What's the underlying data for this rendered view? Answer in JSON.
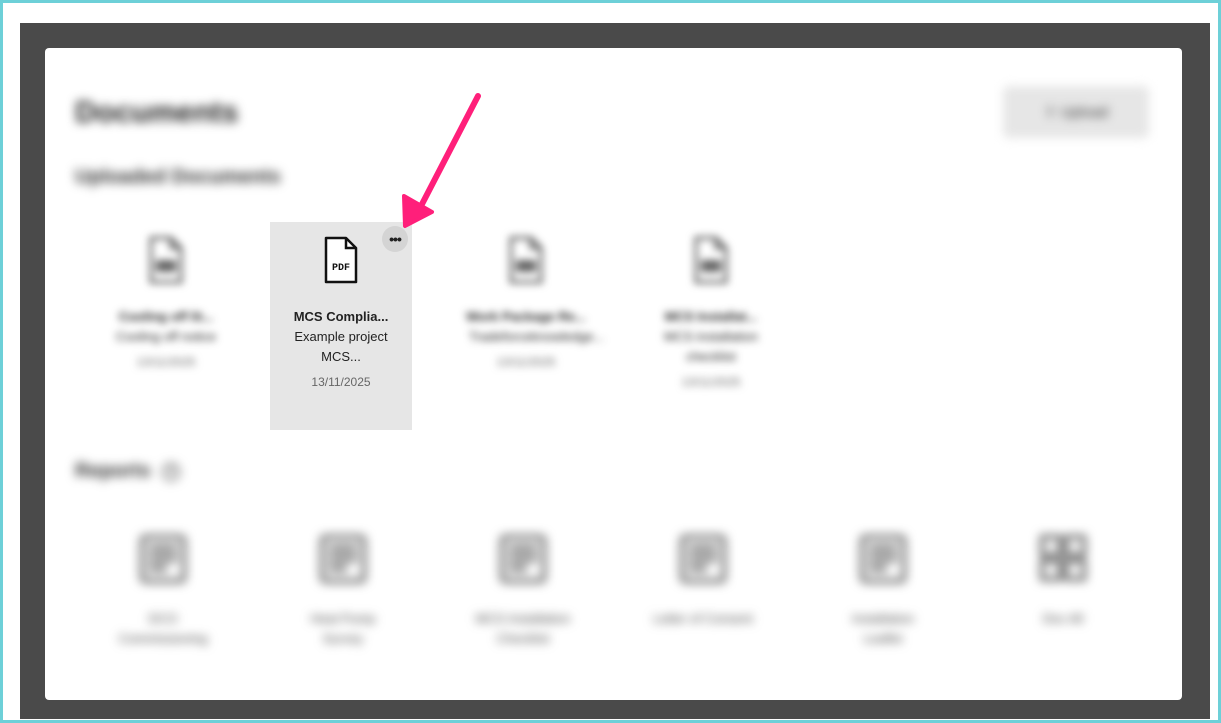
{
  "page": {
    "title": "Documents",
    "upload_label": "⇪ Upload"
  },
  "sections": {
    "uploaded": "Uploaded Documents",
    "reports": "Reports",
    "reports_help_icon": "question-circle-icon"
  },
  "documents": [
    {
      "name": "Cooling off lit...",
      "desc": "Cooling off notice",
      "date": "13/11/2025",
      "icon": "document-icon",
      "blurred": true
    },
    {
      "name": "MCS Complia...",
      "desc": "Example project MCS...",
      "date": "13/11/2025",
      "icon": "pdf-file-icon",
      "blurred": false
    },
    {
      "name": "Work Package Re...",
      "desc": "Tradeforceknowledge...",
      "date": "13/11/2025",
      "icon": "document-icon",
      "blurred": true
    },
    {
      "name": "MCS Installat...",
      "desc": "MCS installation checklist",
      "date": "13/11/2025",
      "icon": "document-icon",
      "blurred": true
    }
  ],
  "reports": [
    {
      "name": "DCO Commissioning",
      "icon": "report-icon"
    },
    {
      "name": "Heat Pump Survey",
      "icon": "report-icon"
    },
    {
      "name": "MCS Installation Checklist",
      "icon": "report-icon"
    },
    {
      "name": "Letter of Consent",
      "icon": "report-icon"
    },
    {
      "name": "Installation Leaflet",
      "icon": "report-icon"
    },
    {
      "name": "Doc All",
      "icon": "grid-icon"
    }
  ],
  "colors": {
    "frame_border": "#6dd0d8",
    "backdrop": "#4a4a4a",
    "annotation_arrow": "#ff1f7a",
    "active_card": "#e6e6e6"
  }
}
